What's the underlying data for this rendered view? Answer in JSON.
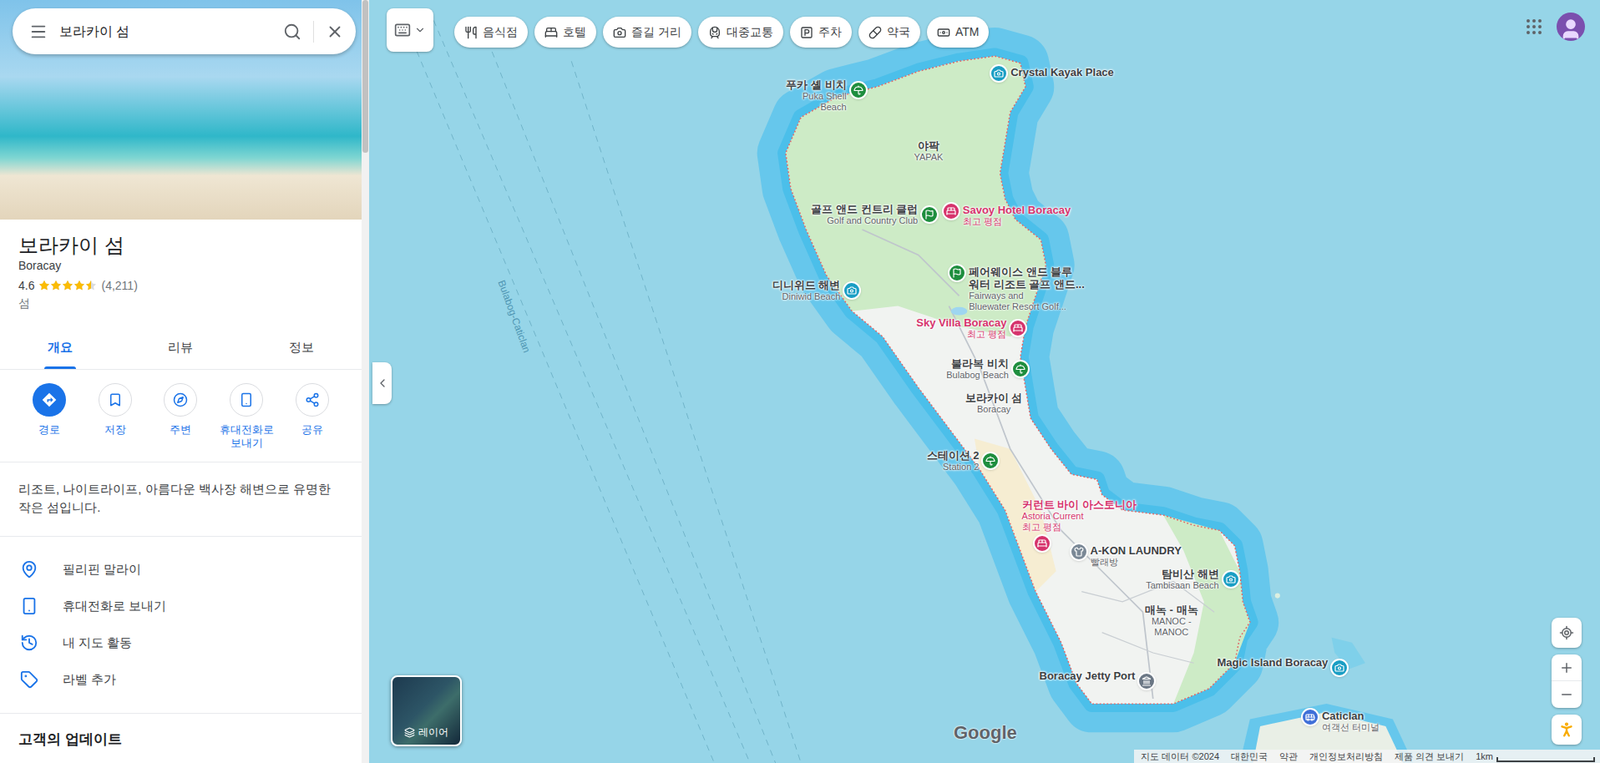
{
  "search": {
    "value": "보라카이 섬"
  },
  "place": {
    "name": "보라카이 섬",
    "subtitle": "Boracay",
    "rating": "4.6",
    "stars": 4.5,
    "reviews": "(4,211)",
    "category": "섬"
  },
  "tabs": [
    {
      "label": "개요",
      "selected": true
    },
    {
      "label": "리뷰",
      "selected": false
    },
    {
      "label": "정보",
      "selected": false
    }
  ],
  "actions": [
    {
      "label": "경로",
      "filled": true
    },
    {
      "label": "저장",
      "filled": false
    },
    {
      "label": "주변",
      "filled": false
    },
    {
      "label": "휴대전화로 보내기",
      "filled": false
    },
    {
      "label": "공유",
      "filled": false
    }
  ],
  "description": "리조트, 나이트라이프, 아름다운 백사장 해변으로 유명한 작은 섬입니다.",
  "info_rows": [
    "필리핀 말라이",
    "휴대전화로 보내기",
    "내 지도 활동",
    "라벨 추가"
  ],
  "section_heading": "고객의 업데이트",
  "chips": [
    "음식점",
    "호텔",
    "즐길 거리",
    "대중교통",
    "주차",
    "약국",
    "ATM"
  ],
  "layer_button": "레이어",
  "route_label": "Bulabog-Caticlan",
  "map_labels": [
    {
      "kind": "camera",
      "title": [
        "Crystal Kayak Place"
      ],
      "subtitle": [],
      "color": "#1a9ec4"
    },
    {
      "kind": "beach",
      "title": [
        "푸카 셸 비치"
      ],
      "subtitle": [
        "Puka Shell",
        "Beach"
      ],
      "color": "#1e8e3e"
    },
    {
      "kind": "area",
      "title": [
        "야팍"
      ],
      "subtitle": [
        "YAPAK"
      ]
    },
    {
      "kind": "golf",
      "title": [
        "골프 앤드 컨트리 클럽"
      ],
      "subtitle": [
        "Golf and Country Club"
      ],
      "color": "#1e8e3e"
    },
    {
      "kind": "hotel",
      "title": [
        "Savoy Hotel Boracay"
      ],
      "subtitle": [
        "최고 평점"
      ],
      "color": "#d6336c"
    },
    {
      "kind": "golf",
      "title": [
        "페어웨이스 앤드 블루",
        "워터 리조트 골프 앤드..."
      ],
      "subtitle": [
        "Fairways and",
        "Bluewater Resort Golf..."
      ],
      "color": "#1e8e3e"
    },
    {
      "kind": "camera",
      "title": [
        "디니위드 해변"
      ],
      "subtitle": [
        "Diniwid Beach"
      ],
      "color": "#1a9ec4"
    },
    {
      "kind": "hotel",
      "title": [
        "Sky Villa Boracay"
      ],
      "subtitle": [
        "최고 평점"
      ],
      "color": "#d6336c"
    },
    {
      "kind": "beach",
      "title": [
        "불라복 비치"
      ],
      "subtitle": [
        "Bulabog Beach"
      ],
      "color": "#1e8e3e"
    },
    {
      "kind": "area",
      "title": [
        "보라카이 섬"
      ],
      "subtitle": [
        "Boracay"
      ]
    },
    {
      "kind": "beach",
      "title": [
        "스테이션 2"
      ],
      "subtitle": [
        "Station 2"
      ],
      "color": "#1e8e3e"
    },
    {
      "kind": "hotel",
      "title": [
        "커런트 바이 아스토니아"
      ],
      "subtitle": [
        "Astoria Current",
        "최고 평점"
      ],
      "color": "#d6336c"
    },
    {
      "kind": "laundry",
      "title": [
        "A-KON LAUNDRY"
      ],
      "subtitle": [
        "빨래방"
      ],
      "color": "#7a8896"
    },
    {
      "kind": "camera",
      "title": [
        "탐비산 해변"
      ],
      "subtitle": [
        "Tambisaan Beach"
      ],
      "color": "#1a9ec4"
    },
    {
      "kind": "area",
      "title": [
        "매녹 - 매녹"
      ],
      "subtitle": [
        "MANOC -",
        "MANOC"
      ]
    },
    {
      "kind": "port",
      "title": [
        "Boracay Jetty Port"
      ],
      "subtitle": [],
      "color": "#6b7785"
    },
    {
      "kind": "camera",
      "title": [
        "Magic Island Boracay"
      ],
      "subtitle": [],
      "color": "#1a9ec4"
    },
    {
      "kind": "bus",
      "title": [
        "Caticlan"
      ],
      "subtitle": [
        "여객선 터미널"
      ],
      "color": "#3f6fd8"
    }
  ],
  "logo": "Google",
  "attribution": [
    "지도 데이터 ©2024",
    "대한민국",
    "약관",
    "개인정보처리방침",
    "제품 의견 보내기"
  ],
  "scale": "1km"
}
